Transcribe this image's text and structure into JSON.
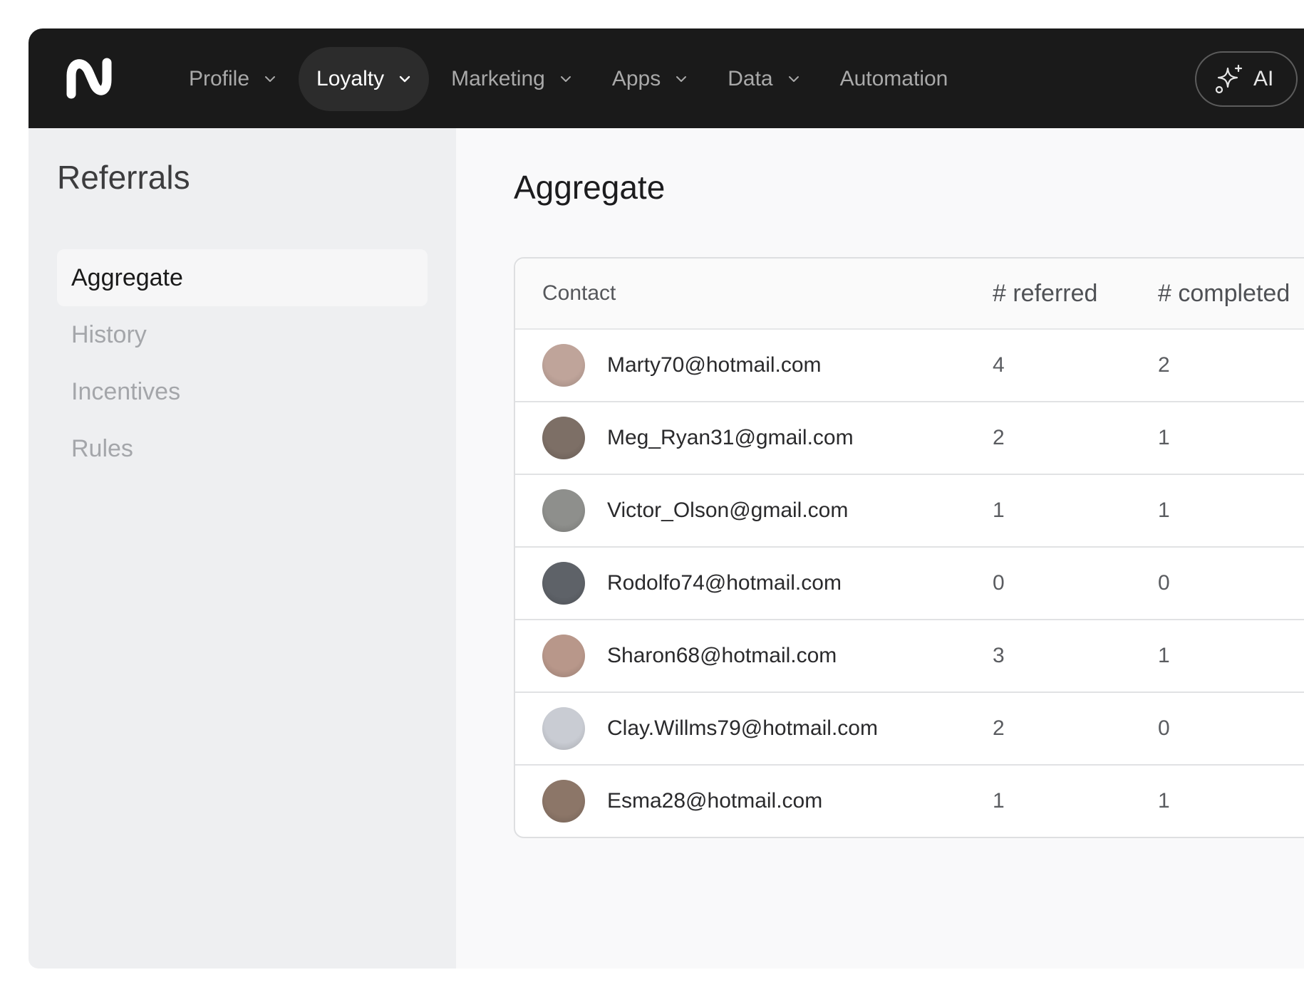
{
  "nav": {
    "items": [
      {
        "label": "Profile",
        "has_chevron": true,
        "active": false
      },
      {
        "label": "Loyalty",
        "has_chevron": true,
        "active": true
      },
      {
        "label": "Marketing",
        "has_chevron": true,
        "active": false
      },
      {
        "label": "Apps",
        "has_chevron": true,
        "active": false
      },
      {
        "label": "Data",
        "has_chevron": true,
        "active": false
      },
      {
        "label": "Automation",
        "has_chevron": false,
        "active": false
      }
    ],
    "ai_label": "AI",
    "ai_icon": "sparkle-icon",
    "logo_icon": "brand-logo-icon"
  },
  "sidebar": {
    "title": "Referrals",
    "items": [
      {
        "label": "Aggregate",
        "active": true
      },
      {
        "label": "History",
        "active": false
      },
      {
        "label": "Incentives",
        "active": false
      },
      {
        "label": "Rules",
        "active": false
      }
    ]
  },
  "main": {
    "title": "Aggregate",
    "table": {
      "headers": {
        "contact": "Contact",
        "referred": "# referred",
        "completed": "# completed"
      },
      "rows": [
        {
          "contact": "Marty70@hotmail.com",
          "referred": "4",
          "completed": "2",
          "avatar_color": "#bfa49a"
        },
        {
          "contact": "Meg_Ryan31@gmail.com",
          "referred": "2",
          "completed": "1",
          "avatar_color": "#7d6f66"
        },
        {
          "contact": "Victor_Olson@gmail.com",
          "referred": "1",
          "completed": "1",
          "avatar_color": "#8e8f8c"
        },
        {
          "contact": "Rodolfo74@hotmail.com",
          "referred": "0",
          "completed": "0",
          "avatar_color": "#5e6268"
        },
        {
          "contact": "Sharon68@hotmail.com",
          "referred": "3",
          "completed": "1",
          "avatar_color": "#b8978a"
        },
        {
          "contact": "Clay.Willms79@hotmail.com",
          "referred": "2",
          "completed": "0",
          "avatar_color": "#c9ccd3"
        },
        {
          "contact": "Esma28@hotmail.com",
          "referred": "1",
          "completed": "1",
          "avatar_color": "#8c7668"
        }
      ]
    }
  }
}
